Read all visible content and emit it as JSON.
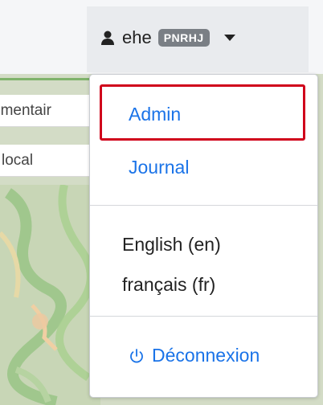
{
  "header": {
    "username": "ehe",
    "badge": "PNRHJ",
    "user_icon": "user-icon",
    "toggle_icon": "caret-down-icon"
  },
  "background_fields": {
    "row1": "ementair",
    "row2": "local"
  },
  "dropdown": {
    "items": [
      {
        "label": "Admin",
        "highlighted": true
      },
      {
        "label": "Journal"
      }
    ],
    "languages": [
      {
        "label": "English (en)"
      },
      {
        "label": "français (fr)"
      }
    ],
    "logout": {
      "label": "Déconnexion",
      "icon": "power-icon"
    }
  },
  "colors": {
    "link": "#1a73e8",
    "badge_bg": "#7a7f85",
    "highlight_border": "#d0021b"
  }
}
